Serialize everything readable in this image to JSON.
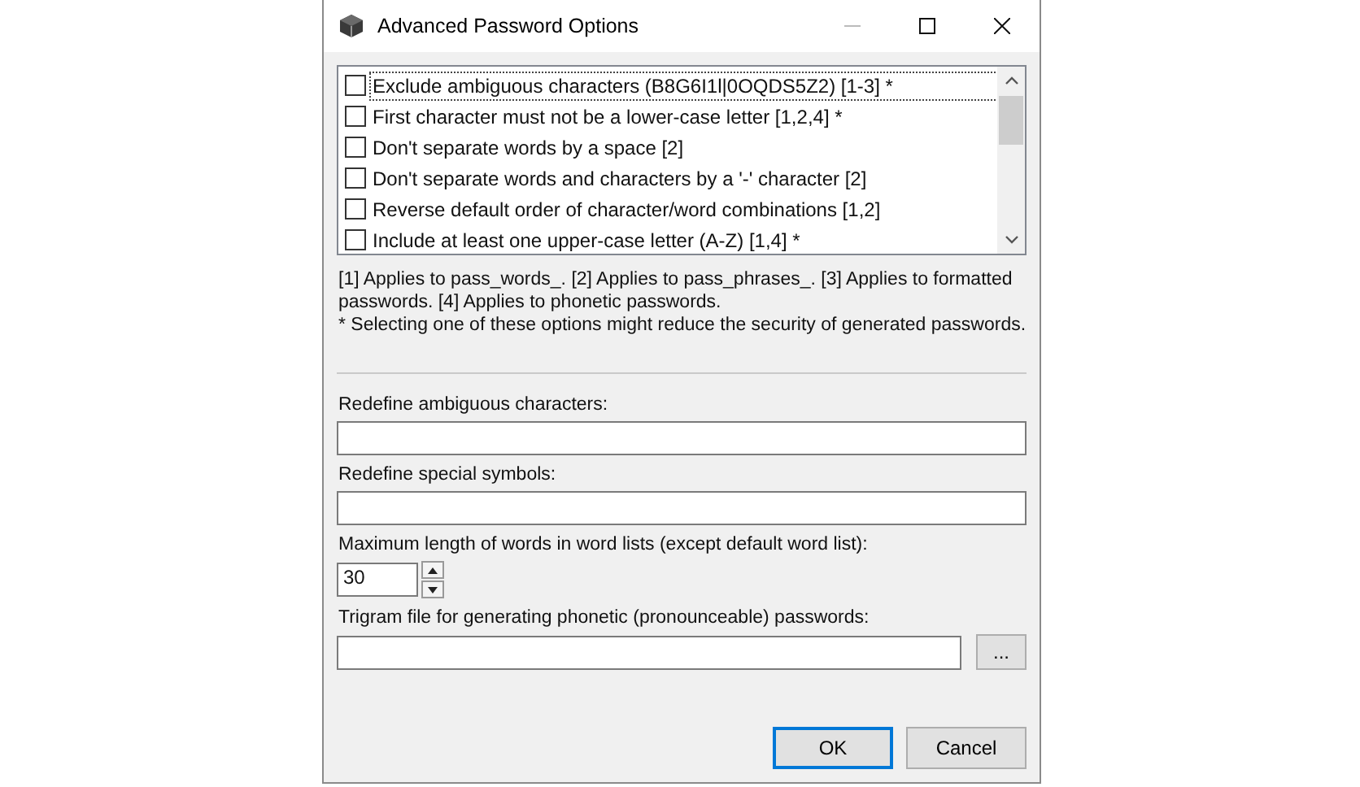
{
  "window": {
    "title": "Advanced Password Options"
  },
  "options": [
    {
      "label": "Exclude ambiguous characters (B8G6I1l|0OQDS5Z2) [1-3] *",
      "checked": false,
      "focused": true
    },
    {
      "label": "First character must not be a lower-case letter [1,2,4] *",
      "checked": false,
      "focused": false
    },
    {
      "label": "Don't separate words by a space [2]",
      "checked": false,
      "focused": false
    },
    {
      "label": "Don't separate words and characters by a '-' character [2]",
      "checked": false,
      "focused": false
    },
    {
      "label": "Reverse default order of character/word combinations [1,2]",
      "checked": false,
      "focused": false
    },
    {
      "label": "Include at least one upper-case letter (A-Z) [1,4] *",
      "checked": false,
      "focused": false
    }
  ],
  "notes": [
    "[1] Applies to pass_words_. [2] Applies to pass_phrases_. [3] Applies to formatted passwords. [4] Applies to phonetic passwords.",
    "* Selecting one of these options might reduce the security of generated passwords."
  ],
  "fields": [
    {
      "kind": "text",
      "label": "Redefine ambiguous characters:"
    },
    {
      "kind": "text",
      "label": "Redefine special symbols:"
    },
    {
      "kind": "spin",
      "label": "Maximum length of words in word lists (except default word list):",
      "value": "30"
    },
    {
      "kind": "file",
      "label": "Trigram file for generating phonetic (pronounceable) passwords:",
      "button": "..."
    }
  ],
  "buttons": [
    {
      "label": "OK",
      "default": true
    },
    {
      "label": "Cancel",
      "default": false
    }
  ]
}
